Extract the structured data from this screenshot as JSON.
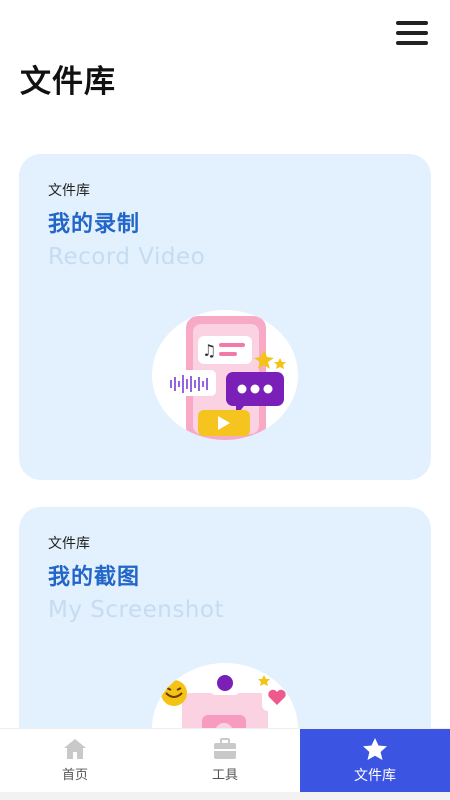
{
  "header": {
    "title": "文件库",
    "menu_icon": "hamburger-menu-icon"
  },
  "cards": [
    {
      "eyebrow": "文件库",
      "title": "我的录制",
      "subtitle": "Record Video",
      "illustration": "phone-music-chat-illustration"
    },
    {
      "eyebrow": "文件库",
      "title": "我的截图",
      "subtitle": "My Screenshot",
      "illustration": "photo-emoji-illustration"
    }
  ],
  "bottom_nav": {
    "items": [
      {
        "label": "首页",
        "icon": "home-icon",
        "active": false
      },
      {
        "label": "工具",
        "icon": "toolbox-icon",
        "active": false
      },
      {
        "label": "文件库",
        "icon": "star-icon",
        "active": true
      }
    ]
  },
  "colors": {
    "accent": "#3b55e2",
    "card_bg": "#e3f0fd",
    "card_title": "#2266c8",
    "card_subtitle": "#c5dcf2"
  }
}
